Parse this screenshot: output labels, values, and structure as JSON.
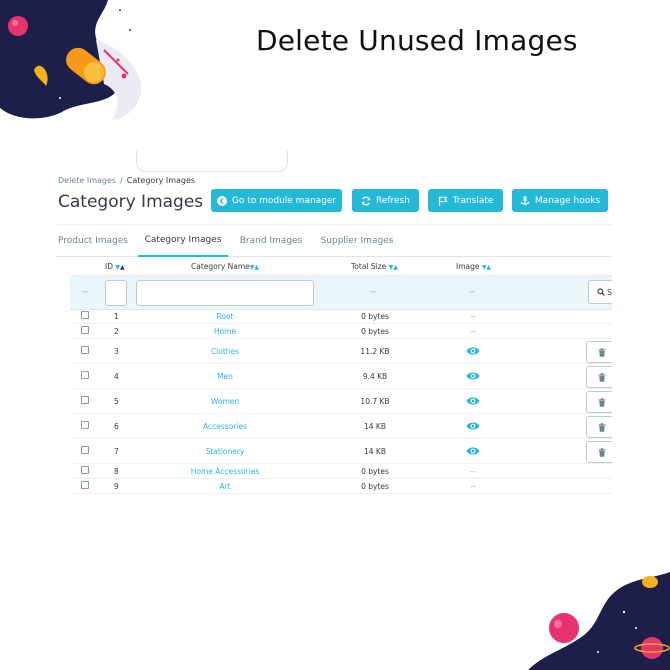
{
  "promo": {
    "title": "Delete Unused Images"
  },
  "breadcrumb": {
    "parent": "Delete Images",
    "separator": "/",
    "current": "Category Images"
  },
  "page": {
    "title": "Category Images"
  },
  "toolbar": {
    "module_manager": "Go to module manager",
    "refresh": "Refresh",
    "translate": "Translate",
    "manage_hooks": "Manage hooks"
  },
  "tabs": [
    {
      "label": "Product Images",
      "active": false
    },
    {
      "label": "Category Images",
      "active": true
    },
    {
      "label": "Brand Images",
      "active": false
    },
    {
      "label": "Supplier Images",
      "active": false
    }
  ],
  "table": {
    "headers": {
      "id": "ID",
      "name": "Category Name",
      "size": "Total Size",
      "image": "Image"
    },
    "filter": {
      "dash": "--",
      "search_label": "S"
    },
    "empty_image": "--",
    "rows": [
      {
        "id": "1",
        "name": "Root",
        "size": "0 bytes",
        "has_image": false
      },
      {
        "id": "2",
        "name": "Home",
        "size": "0 bytes",
        "has_image": false
      },
      {
        "id": "3",
        "name": "Clothes",
        "size": "11.2 KB",
        "has_image": true
      },
      {
        "id": "4",
        "name": "Men",
        "size": "9.4 KB",
        "has_image": true
      },
      {
        "id": "5",
        "name": "Women",
        "size": "10.7 KB",
        "has_image": true
      },
      {
        "id": "6",
        "name": "Accessories",
        "size": "14 KB",
        "has_image": true
      },
      {
        "id": "7",
        "name": "Stationery",
        "size": "14 KB",
        "has_image": true
      },
      {
        "id": "8",
        "name": "Home Accessories",
        "size": "0 bytes",
        "has_image": false
      },
      {
        "id": "9",
        "name": "Art",
        "size": "0 bytes",
        "has_image": false
      }
    ]
  },
  "colors": {
    "accent": "#25b9d7",
    "text": "#363a41",
    "muted": "#6c868e",
    "filter_bg": "#eaf6fa"
  }
}
